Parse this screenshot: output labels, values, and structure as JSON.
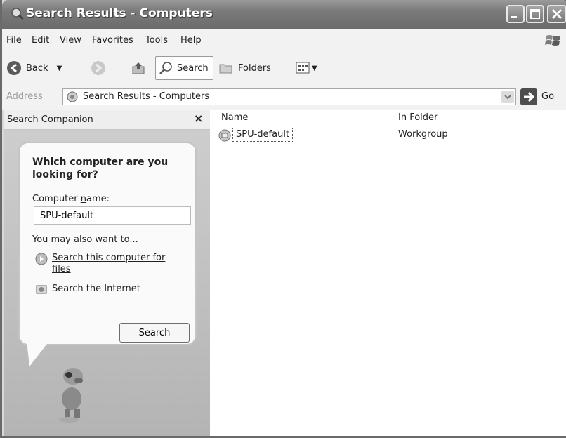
{
  "window": {
    "title": "Search Results - Computers"
  },
  "menu": {
    "items": [
      "File",
      "Edit",
      "View",
      "Favorites",
      "Tools",
      "Help"
    ]
  },
  "toolbar": {
    "back_label": "Back",
    "search_label": "Search",
    "folders_label": "Folders"
  },
  "address": {
    "label": "Address",
    "value": "Search Results - Computers",
    "go_label": "Go"
  },
  "companion": {
    "title": "Search Companion",
    "close_glyph": "×",
    "question": "Which computer are you looking for?",
    "name_label": "Computer name:",
    "name_value": "SPU-default",
    "also_label": "You may also want to...",
    "option_files": "Search this computer for files",
    "option_internet": "Search the Internet",
    "search_button": "Search"
  },
  "results": {
    "columns": [
      "Name",
      "In Folder"
    ],
    "rows": [
      {
        "name": "SPU-default",
        "folder": "Workgroup"
      }
    ]
  }
}
